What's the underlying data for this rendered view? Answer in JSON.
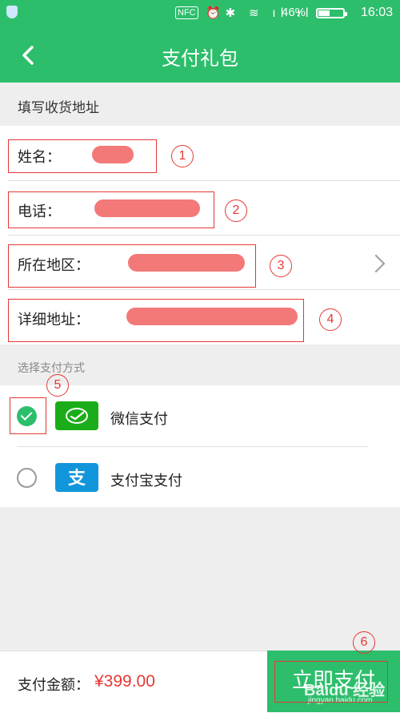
{
  "status_bar": {
    "nfc": "NFC",
    "battery_percent": "46%",
    "battery_level": 0.46,
    "time": "16:03",
    "icons": [
      "shield-icon",
      "alarm-icon",
      "bluetooth-icon",
      "wifi-icon",
      "signal-icon",
      "signal-icon",
      "battery-icon"
    ]
  },
  "header": {
    "title": "支付礼包",
    "back_icon": "back-arrow-icon"
  },
  "address": {
    "section_title": "填写收货地址",
    "name_label": "姓名：",
    "phone_label": "电话：",
    "region_label": "所在地区：",
    "detail_label": "详细地址："
  },
  "payment": {
    "section_title": "选择支付方式",
    "methods": [
      {
        "label": "微信支付",
        "selected": true,
        "icon": "wechat-pay-icon",
        "color": "#1aad19"
      },
      {
        "label": "支付宝支付",
        "selected": false,
        "icon": "alipay-icon",
        "color": "#1296db"
      }
    ]
  },
  "annotations": [
    "1",
    "2",
    "3",
    "4",
    "5",
    "6"
  ],
  "footer": {
    "amount_label": "支付金额：",
    "amount_value": "¥399.00",
    "pay_button": "立即支付",
    "watermark": "Baidu 经验",
    "watermark_url": "jingyan.baidu.com"
  },
  "colors": {
    "accent": "#2dbe6c",
    "annotation": "#e53935",
    "price": "#e53935"
  }
}
